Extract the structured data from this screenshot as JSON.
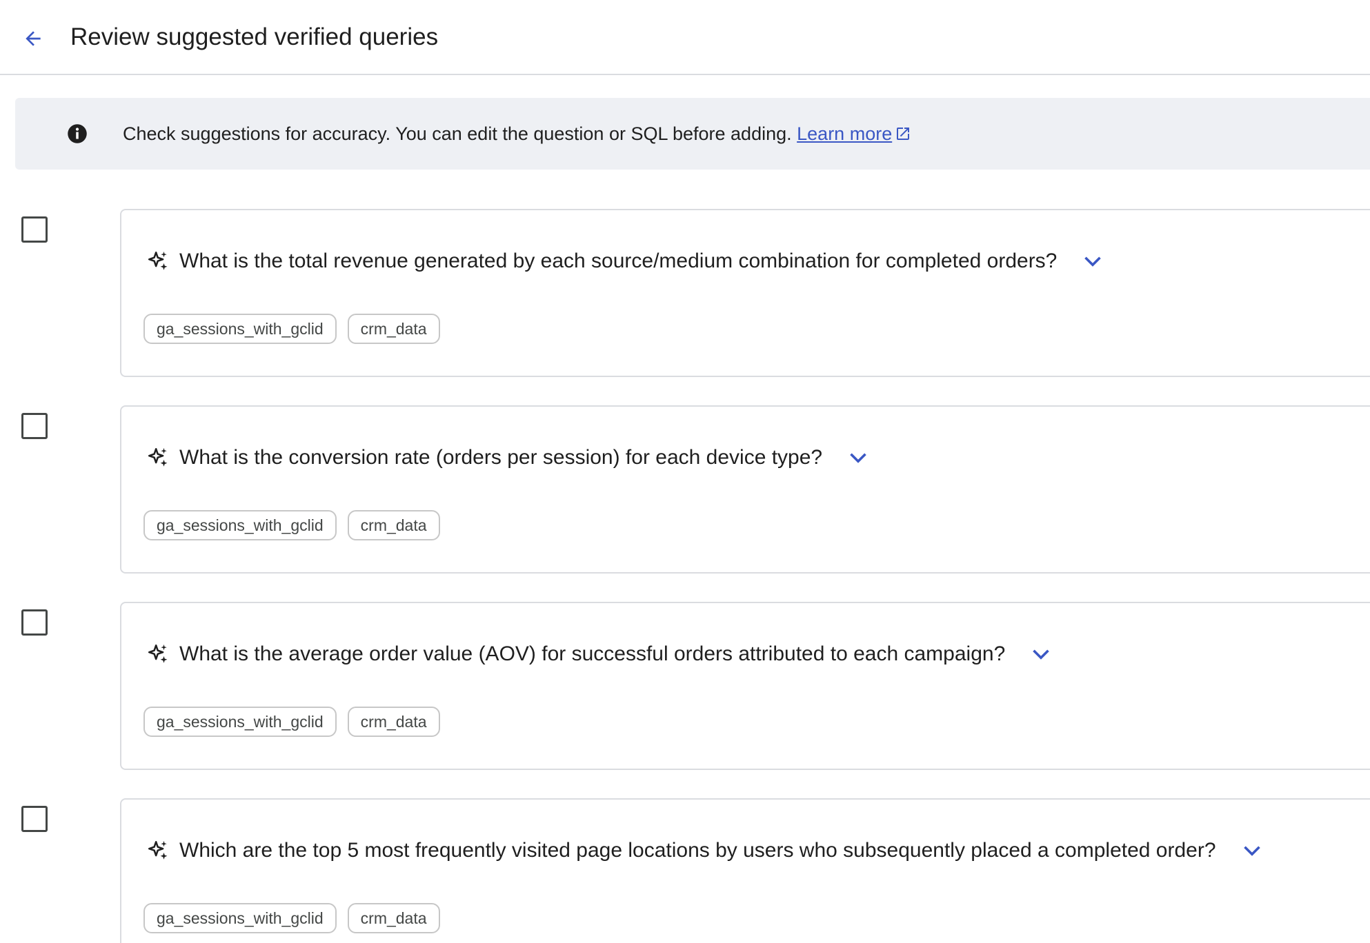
{
  "header": {
    "back_icon": "arrow-back-icon",
    "title": "Review suggested verified queries"
  },
  "banner": {
    "info_icon": "info-icon",
    "text": "Check suggestions for accuracy. You can edit the question or SQL before adding.",
    "link_label": "Learn more",
    "link_icon": "open-in-new-icon"
  },
  "colors": {
    "accent": "#3a57c4",
    "banner_bg": "#eef0f4",
    "border": "#dadce0"
  },
  "queries": [
    {
      "question": "What is the total revenue generated by each source/medium combination for completed orders?",
      "tables": [
        "ga_sessions_with_gclid",
        "crm_data"
      ]
    },
    {
      "question": "What is the conversion rate (orders per session) for each device type?",
      "tables": [
        "ga_sessions_with_gclid",
        "crm_data"
      ]
    },
    {
      "question": "What is the average order value (AOV) for successful orders attributed to each campaign?",
      "tables": [
        "ga_sessions_with_gclid",
        "crm_data"
      ]
    },
    {
      "question": "Which are the top 5 most frequently visited page locations by users who subsequently placed a completed order?",
      "tables": [
        "ga_sessions_with_gclid",
        "crm_data"
      ]
    }
  ]
}
